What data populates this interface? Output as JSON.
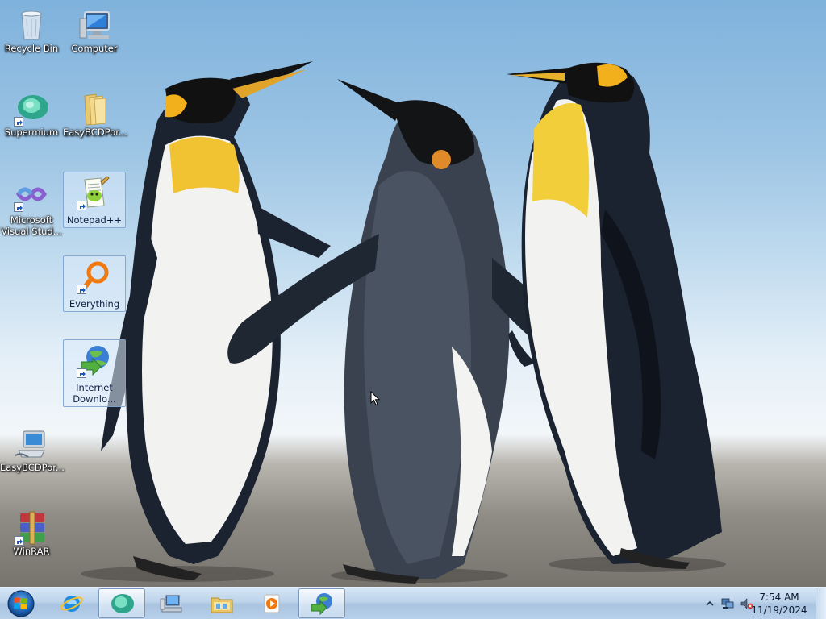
{
  "desktop": {
    "icons": [
      {
        "label": "Recycle Bin",
        "icon": "recycle-bin-icon"
      },
      {
        "label": "Computer",
        "icon": "computer-icon"
      },
      {
        "label": "Supermium",
        "icon": "supermium-icon"
      },
      {
        "label": "EasyBCDPor...",
        "icon": "folder-icon"
      },
      {
        "label": "Microsoft Visual Stud...",
        "icon": "visual-studio-icon"
      },
      {
        "label": "Notepad++",
        "icon": "notepadpp-icon"
      },
      {
        "label": "Everything",
        "icon": "everything-icon"
      },
      {
        "label": "Internet Downlo...",
        "icon": "internet-download-manager-icon"
      },
      {
        "label": "EasyBCDPor...",
        "icon": "easybcd-icon"
      },
      {
        "label": "WinRAR",
        "icon": "winrar-icon"
      }
    ]
  },
  "taskbar": {
    "start": {
      "icon": "windows-start-icon"
    },
    "pinned": [
      {
        "icon": "internet-explorer-icon",
        "active": false
      },
      {
        "icon": "supermium-icon",
        "active": true
      },
      {
        "icon": "computer-network-icon",
        "active": false
      },
      {
        "icon": "file-explorer-icon",
        "active": false
      },
      {
        "icon": "media-player-icon",
        "active": false
      },
      {
        "icon": "internet-download-manager-icon",
        "active": true
      }
    ],
    "tray": {
      "icons": [
        "show-hidden-icons-icon",
        "network-icon",
        "volume-muted-icon"
      ],
      "time": "7:54 AM",
      "date": "11/19/2024"
    }
  },
  "colors": {
    "taskbar_top": "#d6e6f6",
    "taskbar_bottom": "#a9c4e1",
    "selection": "#dcebfc"
  }
}
